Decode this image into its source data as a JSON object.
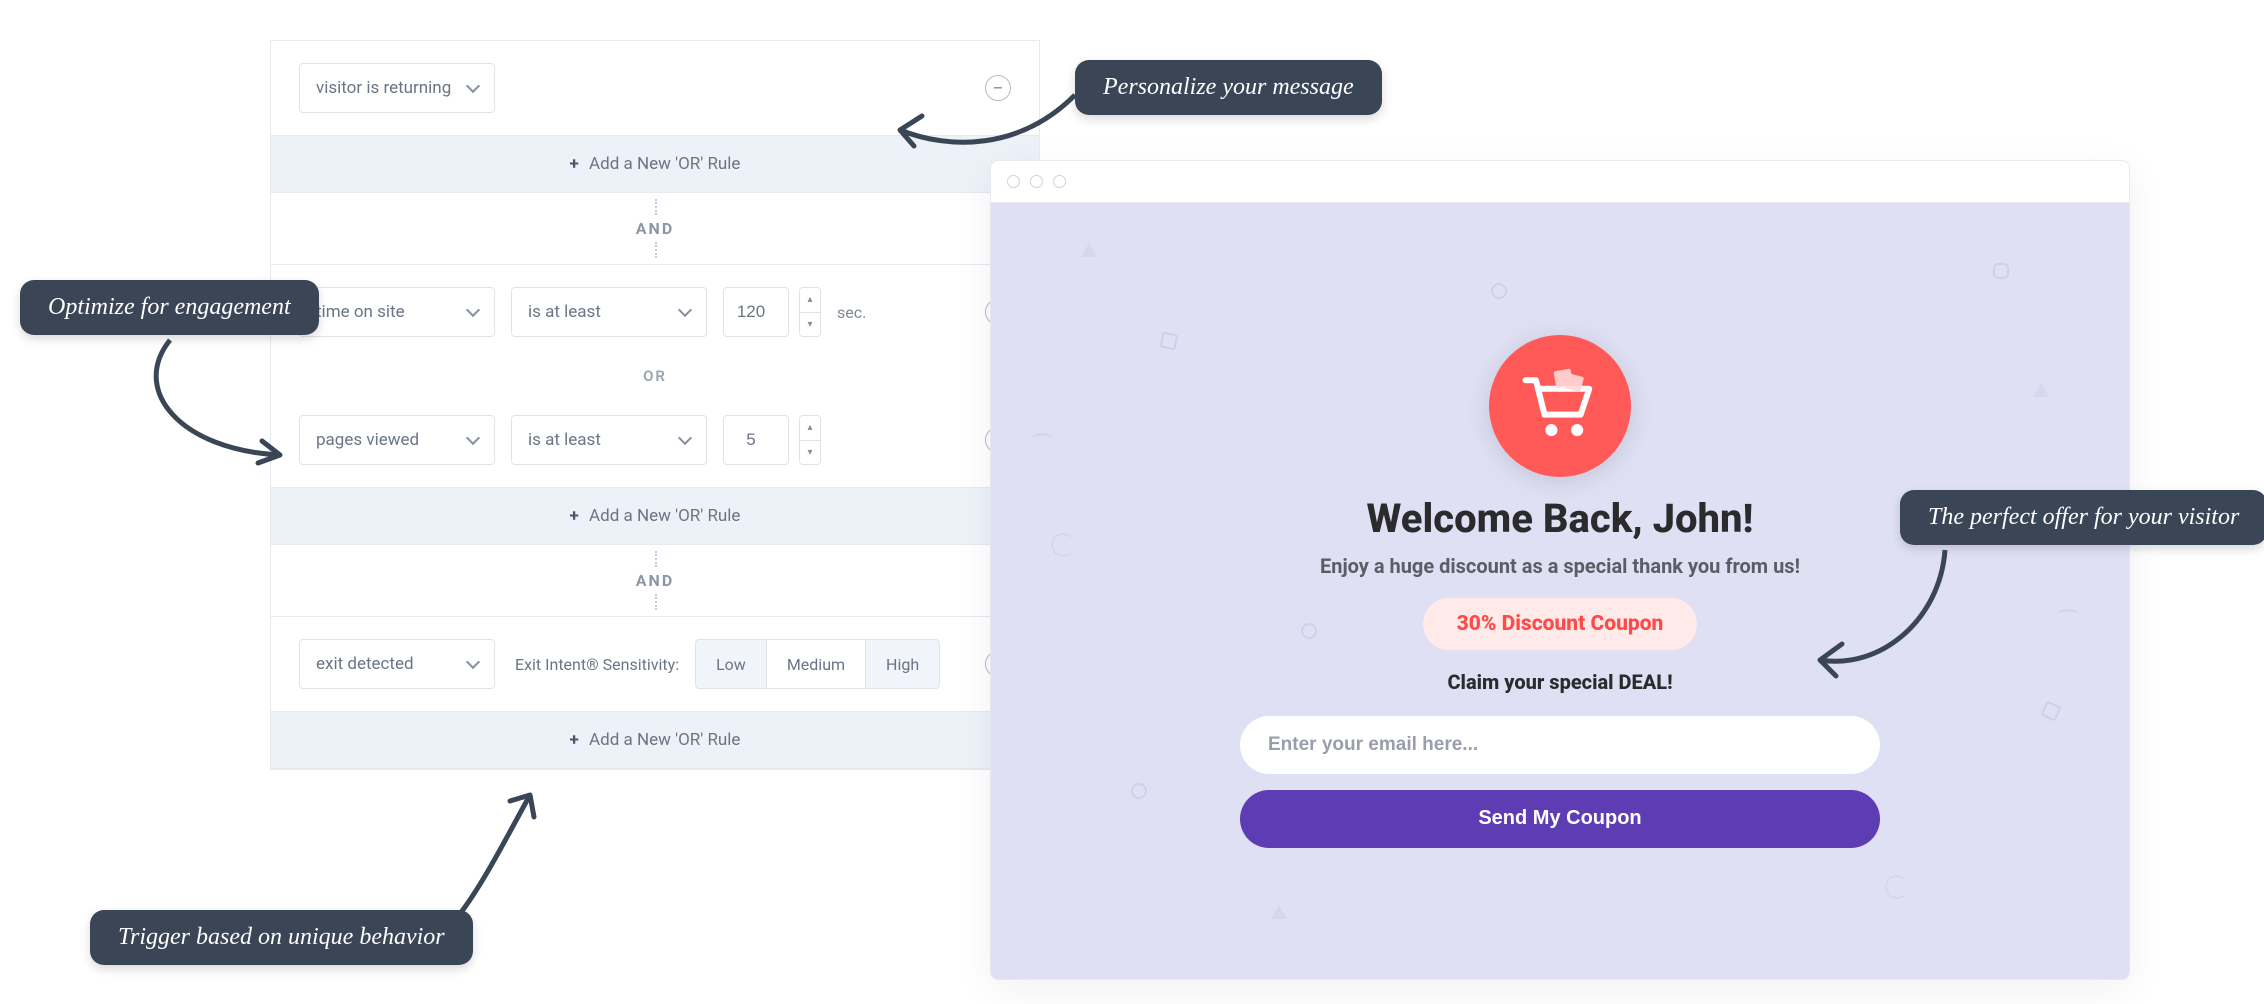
{
  "rules": {
    "group1": {
      "condition1": {
        "field": "visitor is returning"
      },
      "add_or_label": "Add a New 'OR' Rule"
    },
    "and_label": "AND",
    "or_label": "OR",
    "group2": {
      "row1": {
        "field": "time on site",
        "op": "is at least",
        "value": "120",
        "unit": "sec."
      },
      "row2": {
        "field": "pages viewed",
        "op": "is at least",
        "value": "5"
      },
      "add_or_label": "Add a New 'OR' Rule"
    },
    "group3": {
      "row1": {
        "field": "exit detected"
      },
      "sensitivity_label": "Exit Intent® Sensitivity:",
      "sensitivity": {
        "low": "Low",
        "medium": "Medium",
        "high": "High",
        "selected": "Medium"
      },
      "add_or_label": "Add a New 'OR' Rule"
    }
  },
  "popup": {
    "title": "Welcome Back, John!",
    "subtitle": "Enjoy a huge discount as a special thank you from us!",
    "coupon": "30% Discount Coupon",
    "claim": "Claim your special DEAL!",
    "email_placeholder": "Enter your email here...",
    "button": "Send My Coupon"
  },
  "annotations": {
    "engagement": "Optimize for engagement",
    "personalize": "Personalize your message",
    "trigger": "Trigger based on unique behavior",
    "offer": "The perfect offer for your visitor"
  }
}
